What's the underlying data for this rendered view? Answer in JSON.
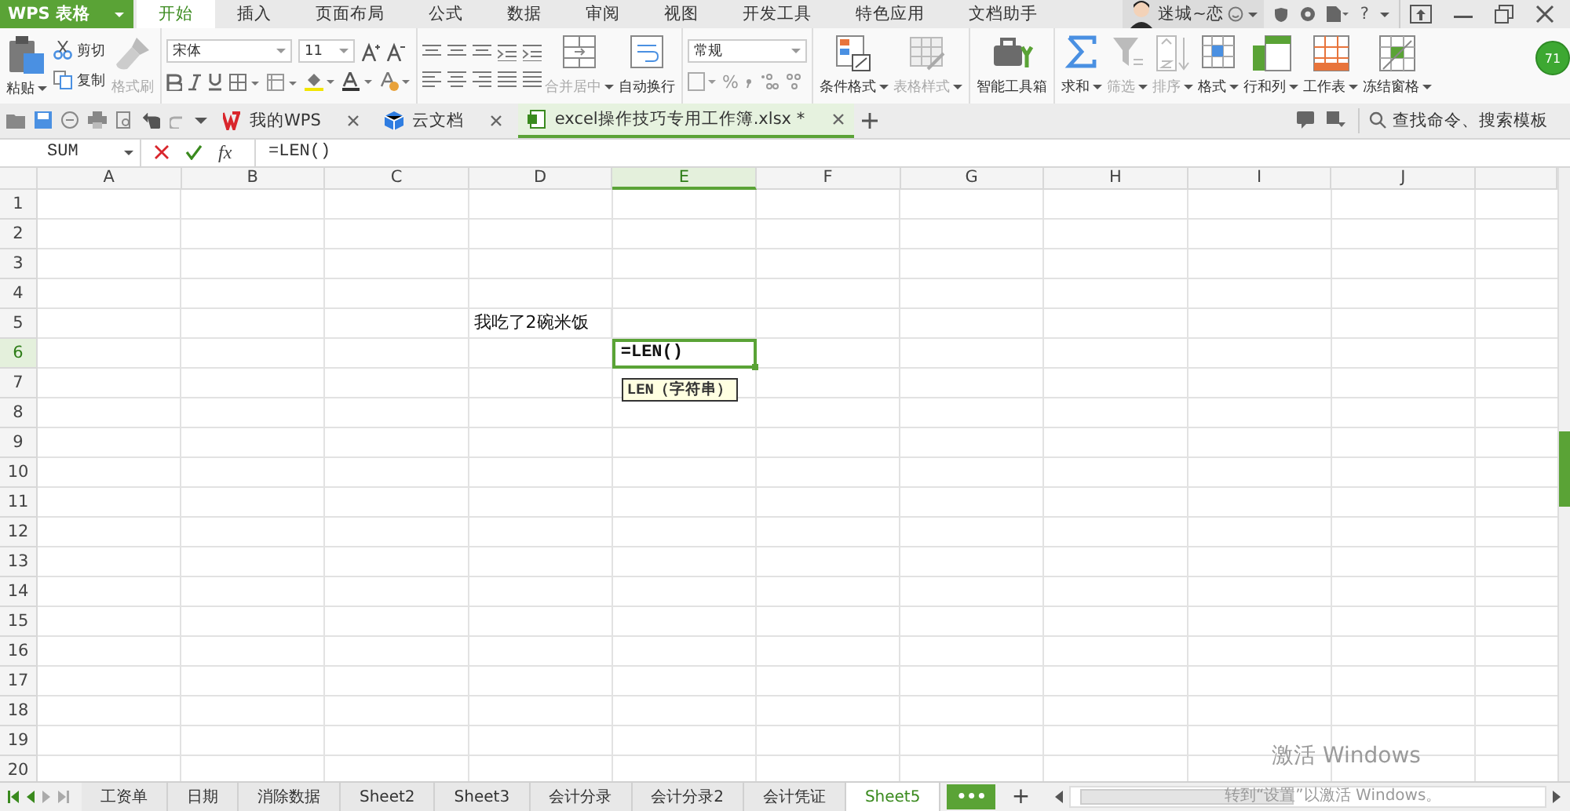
{
  "app": {
    "logo": "WPS 表格"
  },
  "menu_tabs": [
    {
      "label": "开始",
      "selected": true
    },
    {
      "label": "插入",
      "selected": false
    },
    {
      "label": "页面布局",
      "selected": false
    },
    {
      "label": "公式",
      "selected": false
    },
    {
      "label": "数据",
      "selected": false
    },
    {
      "label": "审阅",
      "selected": false
    },
    {
      "label": "视图",
      "selected": false
    },
    {
      "label": "开发工具",
      "selected": false
    },
    {
      "label": "特色应用",
      "selected": false
    },
    {
      "label": "文档助手",
      "selected": false
    }
  ],
  "user": {
    "name": "迷城~恋",
    "help": "?",
    "badge": "71"
  },
  "clipboard": [
    {
      "label": "粘贴",
      "caret": true,
      "disabled": false
    },
    {
      "label": "剪切",
      "caret": false,
      "disabled": false
    },
    {
      "label": "复制",
      "caret": false,
      "disabled": false
    },
    {
      "label": "格式刷",
      "caret": false,
      "disabled": true
    }
  ],
  "font": {
    "name": "宋体",
    "size": "11"
  },
  "alignment": [
    {
      "label": "合并居中",
      "caret": true,
      "disabled": true
    },
    {
      "label": "自动换行",
      "caret": false,
      "disabled": false
    }
  ],
  "number": {
    "format": "常规",
    "percent": "%"
  },
  "styles": [
    {
      "label": "条件格式",
      "caret": true,
      "disabled": false
    },
    {
      "label": "表格样式",
      "caret": true,
      "disabled": true
    },
    {
      "label": "智能工具箱",
      "caret": false,
      "disabled": false
    }
  ],
  "editing": [
    {
      "kind": "sum",
      "label": "求和",
      "caret": true,
      "disabled": false
    },
    {
      "kind": "filter",
      "label": "筛选",
      "caret": true,
      "disabled": true
    },
    {
      "kind": "sort",
      "label": "排序",
      "caret": true,
      "disabled": true
    },
    {
      "kind": "format",
      "label": "格式",
      "caret": true,
      "disabled": false
    },
    {
      "kind": "rowcol",
      "label": "行和列",
      "caret": true,
      "disabled": false
    },
    {
      "kind": "sheet",
      "label": "工作表",
      "caret": true,
      "disabled": false
    },
    {
      "kind": "freeze",
      "label": "冻结窗格",
      "caret": true,
      "disabled": false
    }
  ],
  "doc_tabs": [
    {
      "kind": "wps",
      "label": "我的WPS",
      "selected": false
    },
    {
      "kind": "cloud",
      "label": "云文档",
      "selected": false
    },
    {
      "kind": "sheet",
      "label": "excel操作技巧专用工作簿.xlsx *",
      "selected": true
    }
  ],
  "search": {
    "placeholder": "查找命令、搜索模板"
  },
  "formula_bar": {
    "name_box": "SUM",
    "fx": "fx",
    "value": "=LEN()"
  },
  "grid": {
    "columns": [
      {
        "label": "A",
        "selected": false
      },
      {
        "label": "B",
        "selected": false
      },
      {
        "label": "C",
        "selected": false
      },
      {
        "label": "D",
        "selected": false
      },
      {
        "label": "E",
        "selected": true
      },
      {
        "label": "F",
        "selected": false
      },
      {
        "label": "G",
        "selected": false
      },
      {
        "label": "H",
        "selected": false
      },
      {
        "label": "I",
        "selected": false
      },
      {
        "label": "J",
        "selected": false
      }
    ],
    "rows": [
      {
        "header": "1",
        "selected": false
      },
      {
        "header": "2",
        "selected": false
      },
      {
        "header": "3",
        "selected": false
      },
      {
        "header": "4",
        "selected": false
      },
      {
        "header": "5",
        "selected": false,
        "cells": {
          "D": {
            "text": "我吃了2碗米饭",
            "editing": false
          }
        }
      },
      {
        "header": "6",
        "selected": true,
        "cells": {
          "E": {
            "text": "=LEN()",
            "editing": true
          }
        }
      },
      {
        "header": "7",
        "selected": false
      },
      {
        "header": "8",
        "selected": false
      },
      {
        "header": "9",
        "selected": false
      },
      {
        "header": "10",
        "selected": false
      },
      {
        "header": "11",
        "selected": false
      },
      {
        "header": "12",
        "selected": false
      },
      {
        "header": "13",
        "selected": false
      },
      {
        "header": "14",
        "selected": false
      },
      {
        "header": "15",
        "selected": false
      },
      {
        "header": "16",
        "selected": false
      },
      {
        "header": "17",
        "selected": false
      },
      {
        "header": "18",
        "selected": false
      },
      {
        "header": "19",
        "selected": false
      },
      {
        "header": "20",
        "selected": false
      }
    ],
    "tooltip": "LEN（字符串）"
  },
  "sheets": [
    {
      "label": "工资单",
      "selected": false
    },
    {
      "label": "日期",
      "selected": false
    },
    {
      "label": "消除数据",
      "selected": false
    },
    {
      "label": "Sheet2",
      "selected": false
    },
    {
      "label": "Sheet3",
      "selected": false
    },
    {
      "label": "会计分录",
      "selected": false
    },
    {
      "label": "会计分录2",
      "selected": false
    },
    {
      "label": "会计凭证",
      "selected": false
    },
    {
      "label": "Sheet5",
      "selected": true
    }
  ],
  "sheet_actions": {
    "more": "•••",
    "add": "+"
  },
  "os_notice": {
    "title": "激活 Windows",
    "detail": "转到“设置”以激活 Windows。"
  }
}
